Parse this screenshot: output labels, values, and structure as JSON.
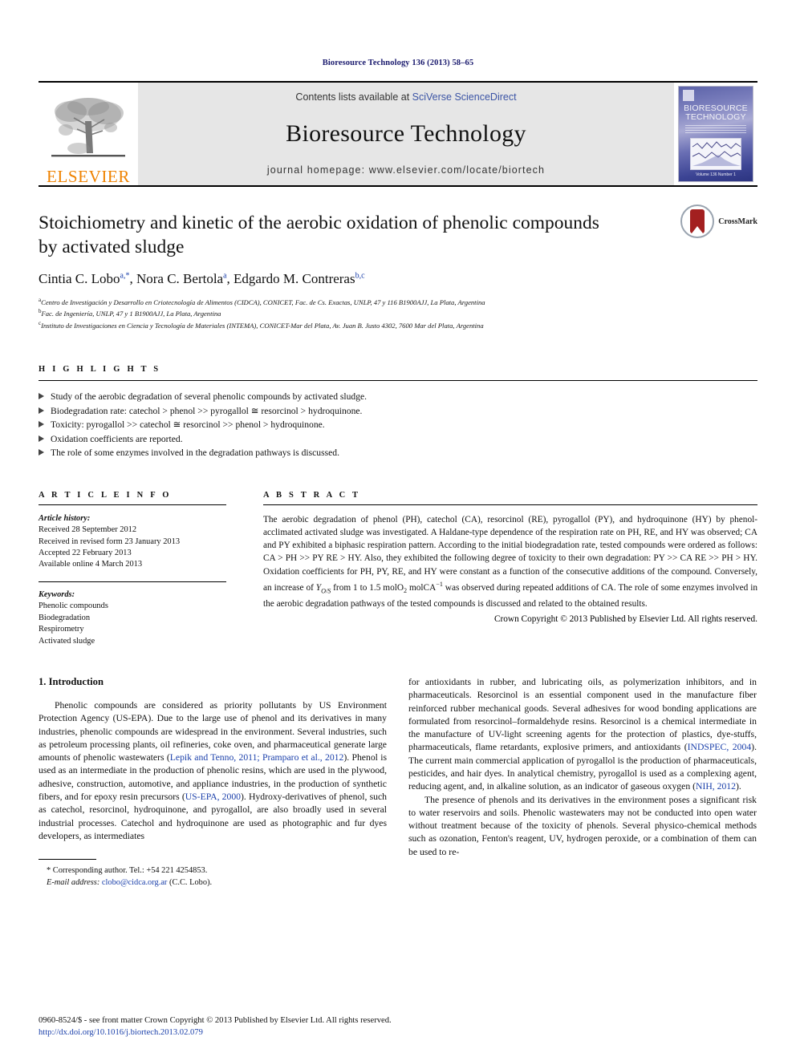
{
  "running_head": "Bioresource Technology 136 (2013) 58–65",
  "masthead": {
    "contents_prefix": "Contents lists available at ",
    "sciencedirect": "SciVerse ScienceDirect",
    "journal_title": "Bioresource Technology",
    "homepage": "journal homepage: www.elsevier.com/locate/biortech",
    "publisher": "ELSEVIER",
    "cover": {
      "name_line1": "BIORESOURCE",
      "name_line2": "TECHNOLOGY",
      "footer": "Volume 136  Number 1"
    }
  },
  "article": {
    "title": "Stoichiometry and kinetic of the aerobic oxidation of phenolic compounds by activated sludge",
    "authors_html": "Cintia C. Lobo, Nora C. Bertola, Edgardo M. Contreras",
    "author_list": [
      {
        "name": "Cintia C. Lobo",
        "marks": "a,*"
      },
      {
        "name": "Nora C. Bertola",
        "marks": "a"
      },
      {
        "name": "Edgardo M. Contreras",
        "marks": "b,c"
      }
    ],
    "affiliations": [
      {
        "mark": "a",
        "text": "Centro de Investigación y Desarrollo en Criotecnología de Alimentos (CIDCA), CONICET, Fac. de Cs. Exactas, UNLP, 47 y 116 B1900AJJ, La Plata, Argentina"
      },
      {
        "mark": "b",
        "text": "Fac. de Ingeniería, UNLP, 47 y 1 B1900AJJ, La Plata, Argentina"
      },
      {
        "mark": "c",
        "text": "Instituto de Investigaciones en Ciencia y Tecnología de Materiales (INTEMA), CONICET-Mar del Plata, Av. Juan B. Justo 4302, 7600 Mar del Plata, Argentina"
      }
    ],
    "crossmark_label": "CrossMark"
  },
  "highlights": {
    "heading": "H I G H L I G H T S",
    "items": [
      "Study of the aerobic degradation of several phenolic compounds by activated sludge.",
      "Biodegradation rate: catechol > phenol >> pyrogallol ≅ resorcinol > hydroquinone.",
      "Toxicity: pyrogallol >> catechol ≅ resorcinol >> phenol > hydroquinone.",
      "Oxidation coefficients are reported.",
      "The role of some enzymes involved in the degradation pathways is discussed."
    ]
  },
  "article_info": {
    "heading": "A R T I C L E    I N F O",
    "history_label": "Article history:",
    "history": [
      "Received 28 September 2012",
      "Received in revised form 23 January 2013",
      "Accepted 22 February 2013",
      "Available online 4 March 2013"
    ],
    "keywords_label": "Keywords:",
    "keywords": [
      "Phenolic compounds",
      "Biodegradation",
      "Respirometry",
      "Activated sludge"
    ]
  },
  "abstract": {
    "heading": "A B S T R A C T",
    "paragraph_1": "The aerobic degradation of phenol (PH), catechol (CA), resorcinol (RE), pyrogallol (PY), and hydroquinone (HY) by phenol-acclimated activated sludge was investigated. A Haldane-type dependence of the respiration rate on PH, RE, and HY was observed; CA and PY exhibited a biphasic respiration pattern. According to the initial biodegradation rate, tested compounds were ordered as follows: CA > PH >> PY  RE > HY. Also, they exhibited the following degree of toxicity to their own degradation: PY >> CA  RE >> PH > HY. Oxidation coefficients for PH, PY, RE, and HY were constant as a function of the consecutive additions of the compound. Conversely, an increase of ",
    "yield_symbol": "Y",
    "yield_sub": "O/S",
    "paragraph_2_mid": " from 1 to 1.5 molO",
    "paragraph_2_o2sub": "2",
    "paragraph_2_units": " molCA",
    "paragraph_2_exp": "−1",
    "paragraph_3": " was observed during repeated additions of CA. The role of some enzymes involved in the aerobic degradation pathways of the tested compounds is discussed and related to the obtained results.",
    "copyright": "Crown Copyright © 2013 Published by Elsevier Ltd. All rights reserved."
  },
  "intro": {
    "heading": "1. Introduction",
    "left_p1_a": "Phenolic compounds are considered as priority pollutants by US Environment Protection Agency (US-EPA). Due to the large use of phenol and its derivatives in many industries, phenolic compounds are widespread in the environment. Several industries, such as petroleum processing plants, oil refineries, coke oven, and pharmaceutical generate large amounts of phenolic wastewaters (",
    "left_cite1": "Lepik and Tenno, 2011; Pramparo et al., 2012",
    "left_p1_b": "). Phenol is used as an intermediate in the production of phenolic resins, which are used in the plywood, adhesive, construction, automotive, and appliance industries, in the production of synthetic fibers, and for epoxy resin precursors (",
    "left_cite2": "US-EPA, 2000",
    "left_p1_c": "). Hydroxy-derivatives of phenol, such as catechol, resorcinol, hydroquinone, and pyrogallol, are also broadly used in several industrial processes. Catechol and hydroquinone are used as photographic and fur dyes developers, as intermediates",
    "right_p1_a": "for antioxidants in rubber, and lubricating oils, as polymerization inhibitors, and in pharmaceuticals. Resorcinol is an essential component used in the manufacture fiber reinforced rubber mechanical goods. Several adhesives for wood bonding applications are formulated from resorcinol–formaldehyde resins. Resorcinol is a chemical intermediate in the manufacture of UV-light screening agents for the protection of plastics, dye-stuffs, pharmaceuticals, flame retardants, explosive primers, and antioxidants (",
    "right_cite1": "INDSPEC, 2004",
    "right_p1_b": "). The current main commercial application of pyrogallol is the production of pharmaceuticals, pesticides, and hair dyes. In analytical chemistry, pyrogallol is used as a complexing agent, reducing agent, and, in alkaline solution, as an indicator of gaseous oxygen (",
    "right_cite2": "NIH, 2012",
    "right_p1_c": ").",
    "right_p2": "The presence of phenols and its derivatives in the environment poses a significant risk to water reservoirs and soils. Phenolic wastewaters may not be conducted into open water without treatment because of the toxicity of phenols. Several physico-chemical methods such as ozonation, Fenton's reagent, UV, hydrogen peroxide, or a combination of them can be used to re-"
  },
  "footnote": {
    "corresponding": "* Corresponding author. Tel.: +54 221 4254853.",
    "email_label": "E-mail address:",
    "email": "clobo@cidca.org.ar",
    "email_owner": "(C.C. Lobo)."
  },
  "imprint": {
    "line1": "0960-8524/$ - see front matter Crown Copyright © 2013 Published by Elsevier Ltd. All rights reserved.",
    "doi": "http://dx.doi.org/10.1016/j.biortech.2013.02.079"
  },
  "colors": {
    "link": "#1a3faa",
    "running_head": "#1a1a6e",
    "elsevier_orange": "#ef8200",
    "masthead_bg": "#e6e6e6"
  }
}
